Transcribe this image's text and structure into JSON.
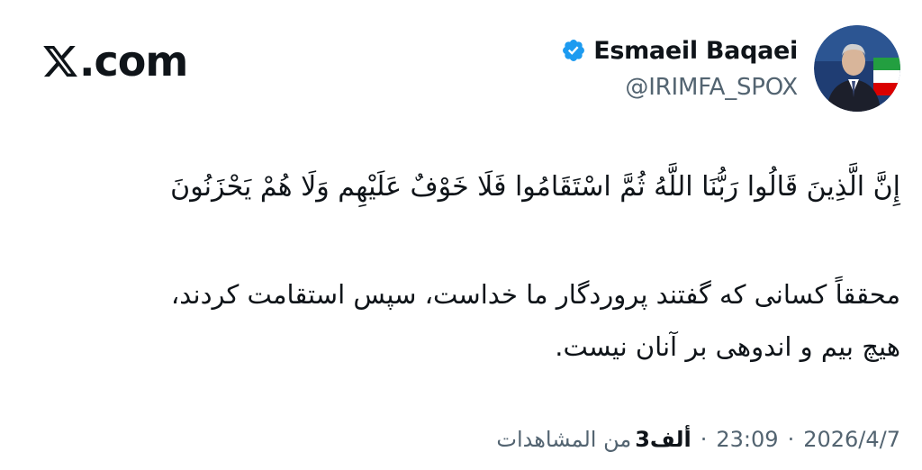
{
  "brand": {
    "text": ".com",
    "logo_icon": "x-logo-icon"
  },
  "author": {
    "name": "Esmaeil Baqaei",
    "handle": "@IRIMFA_SPOX",
    "verified_icon": "verified-badge-icon",
    "avatar_icon": "avatar"
  },
  "tweet": {
    "verse": "إِنَّ الَّذِينَ قَالُوا رَبُّنَا اللَّهُ ثُمَّ اسْتَقَامُوا فَلَا خَوْفٌ عَلَيْهِم وَلَا هُمْ يَحْزَنُونَ",
    "translation_lines": [
      "محققاً کسانی که گفتند پروردگار ما خداست، سپس استقامت کردند،",
      "هیچ بیم و اندوهی بر آنان نیست."
    ]
  },
  "meta": {
    "date": "2026/4/7",
    "time": "23:09",
    "views_count": "3ألف",
    "views_label": "من المشاهدات",
    "separator": "·"
  },
  "colors": {
    "text_primary": "#0f1419",
    "text_secondary": "#536471",
    "verified": "#1d9bf0"
  }
}
